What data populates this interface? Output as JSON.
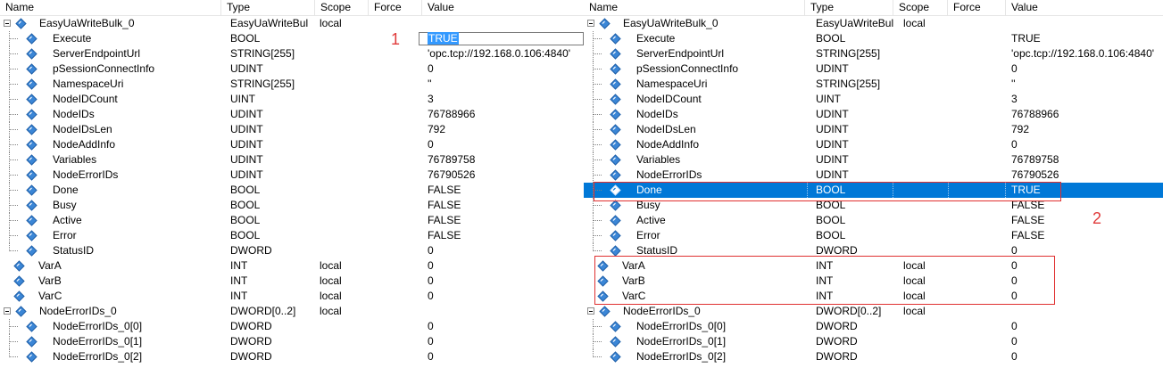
{
  "columns": {
    "name": "Name",
    "type": "Type",
    "scope": "Scope",
    "force": "Force",
    "value": "Value"
  },
  "left_rows": [
    {
      "name": "EasyUaWriteBulk_0",
      "type": "EasyUaWriteBul",
      "scope": "local",
      "value": "",
      "level": 0,
      "expander": true
    },
    {
      "name": "Execute",
      "type": "BOOL",
      "scope": "",
      "value": "TRUE",
      "level": 1,
      "editing": true
    },
    {
      "name": "ServerEndpointUrl",
      "type": "STRING[255]",
      "scope": "",
      "value": "'opc.tcp://192.168.0.106:4840'",
      "level": 1
    },
    {
      "name": "pSessionConnectInfo",
      "type": "UDINT",
      "scope": "",
      "value": "0",
      "level": 1
    },
    {
      "name": "NamespaceUri",
      "type": "STRING[255]",
      "scope": "",
      "value": "''",
      "level": 1
    },
    {
      "name": "NodeIDCount",
      "type": "UINT",
      "scope": "",
      "value": "3",
      "level": 1
    },
    {
      "name": "NodeIDs",
      "type": "UDINT",
      "scope": "",
      "value": "76788966",
      "level": 1
    },
    {
      "name": "NodeIDsLen",
      "type": "UDINT",
      "scope": "",
      "value": "792",
      "level": 1
    },
    {
      "name": "NodeAddInfo",
      "type": "UDINT",
      "scope": "",
      "value": "0",
      "level": 1
    },
    {
      "name": "Variables",
      "type": "UDINT",
      "scope": "",
      "value": "76789758",
      "level": 1
    },
    {
      "name": "NodeErrorIDs",
      "type": "UDINT",
      "scope": "",
      "value": "76790526",
      "level": 1
    },
    {
      "name": "Done",
      "type": "BOOL",
      "scope": "",
      "value": "FALSE",
      "level": 1
    },
    {
      "name": "Busy",
      "type": "BOOL",
      "scope": "",
      "value": "FALSE",
      "level": 1
    },
    {
      "name": "Active",
      "type": "BOOL",
      "scope": "",
      "value": "FALSE",
      "level": 1
    },
    {
      "name": "Error",
      "type": "BOOL",
      "scope": "",
      "value": "FALSE",
      "level": 1
    },
    {
      "name": "StatusID",
      "type": "DWORD",
      "scope": "",
      "value": "0",
      "level": 1,
      "last": true
    },
    {
      "name": "VarA",
      "type": "INT",
      "scope": "local",
      "value": "0",
      "level": 0
    },
    {
      "name": "VarB",
      "type": "INT",
      "scope": "local",
      "value": "0",
      "level": 0
    },
    {
      "name": "VarC",
      "type": "INT",
      "scope": "local",
      "value": "0",
      "level": 0
    },
    {
      "name": "NodeErrorIDs_0",
      "type": "DWORD[0..2]",
      "scope": "local",
      "value": "",
      "level": 0,
      "expander": true
    },
    {
      "name": "NodeErrorIDs_0[0]",
      "type": "DWORD",
      "scope": "",
      "value": "0",
      "level": 1
    },
    {
      "name": "NodeErrorIDs_0[1]",
      "type": "DWORD",
      "scope": "",
      "value": "0",
      "level": 1
    },
    {
      "name": "NodeErrorIDs_0[2]",
      "type": "DWORD",
      "scope": "",
      "value": "0",
      "level": 1,
      "last": true
    }
  ],
  "right_rows": [
    {
      "name": "EasyUaWriteBulk_0",
      "type": "EasyUaWriteBul",
      "scope": "local",
      "value": "",
      "level": 0,
      "expander": true
    },
    {
      "name": "Execute",
      "type": "BOOL",
      "scope": "",
      "value": "TRUE",
      "level": 1
    },
    {
      "name": "ServerEndpointUrl",
      "type": "STRING[255]",
      "scope": "",
      "value": "'opc.tcp://192.168.0.106:4840'",
      "level": 1
    },
    {
      "name": "pSessionConnectInfo",
      "type": "UDINT",
      "scope": "",
      "value": "0",
      "level": 1
    },
    {
      "name": "NamespaceUri",
      "type": "STRING[255]",
      "scope": "",
      "value": "''",
      "level": 1
    },
    {
      "name": "NodeIDCount",
      "type": "UINT",
      "scope": "",
      "value": "3",
      "level": 1
    },
    {
      "name": "NodeIDs",
      "type": "UDINT",
      "scope": "",
      "value": "76788966",
      "level": 1
    },
    {
      "name": "NodeIDsLen",
      "type": "UDINT",
      "scope": "",
      "value": "792",
      "level": 1
    },
    {
      "name": "NodeAddInfo",
      "type": "UDINT",
      "scope": "",
      "value": "0",
      "level": 1
    },
    {
      "name": "Variables",
      "type": "UDINT",
      "scope": "",
      "value": "76789758",
      "level": 1
    },
    {
      "name": "NodeErrorIDs",
      "type": "UDINT",
      "scope": "",
      "value": "76790526",
      "level": 1
    },
    {
      "name": "Done",
      "type": "BOOL",
      "scope": "",
      "value": "TRUE",
      "level": 1,
      "selected": true
    },
    {
      "name": "Busy",
      "type": "BOOL",
      "scope": "",
      "value": "FALSE",
      "level": 1
    },
    {
      "name": "Active",
      "type": "BOOL",
      "scope": "",
      "value": "FALSE",
      "level": 1
    },
    {
      "name": "Error",
      "type": "BOOL",
      "scope": "",
      "value": "FALSE",
      "level": 1
    },
    {
      "name": "StatusID",
      "type": "DWORD",
      "scope": "",
      "value": "0",
      "level": 1,
      "last": true
    },
    {
      "name": "VarA",
      "type": "INT",
      "scope": "local",
      "value": "0",
      "level": 0
    },
    {
      "name": "VarB",
      "type": "INT",
      "scope": "local",
      "value": "0",
      "level": 0
    },
    {
      "name": "VarC",
      "type": "INT",
      "scope": "local",
      "value": "0",
      "level": 0
    },
    {
      "name": "NodeErrorIDs_0",
      "type": "DWORD[0..2]",
      "scope": "local",
      "value": "",
      "level": 0,
      "expander": true
    },
    {
      "name": "NodeErrorIDs_0[0]",
      "type": "DWORD",
      "scope": "",
      "value": "0",
      "level": 1
    },
    {
      "name": "NodeErrorIDs_0[1]",
      "type": "DWORD",
      "scope": "",
      "value": "0",
      "level": 1
    },
    {
      "name": "NodeErrorIDs_0[2]",
      "type": "DWORD",
      "scope": "",
      "value": "0",
      "level": 1,
      "last": true
    }
  ],
  "annotations": {
    "left_marker": "1",
    "right_marker": "2"
  },
  "icons": {
    "variable": "variable-diamond-icon",
    "expander": "collapse-minus-icon"
  },
  "colors": {
    "selection": "#0078d7",
    "edit_selection": "#3399ff",
    "annotation": "#e03030",
    "icon_fill": "#3b86d6"
  }
}
